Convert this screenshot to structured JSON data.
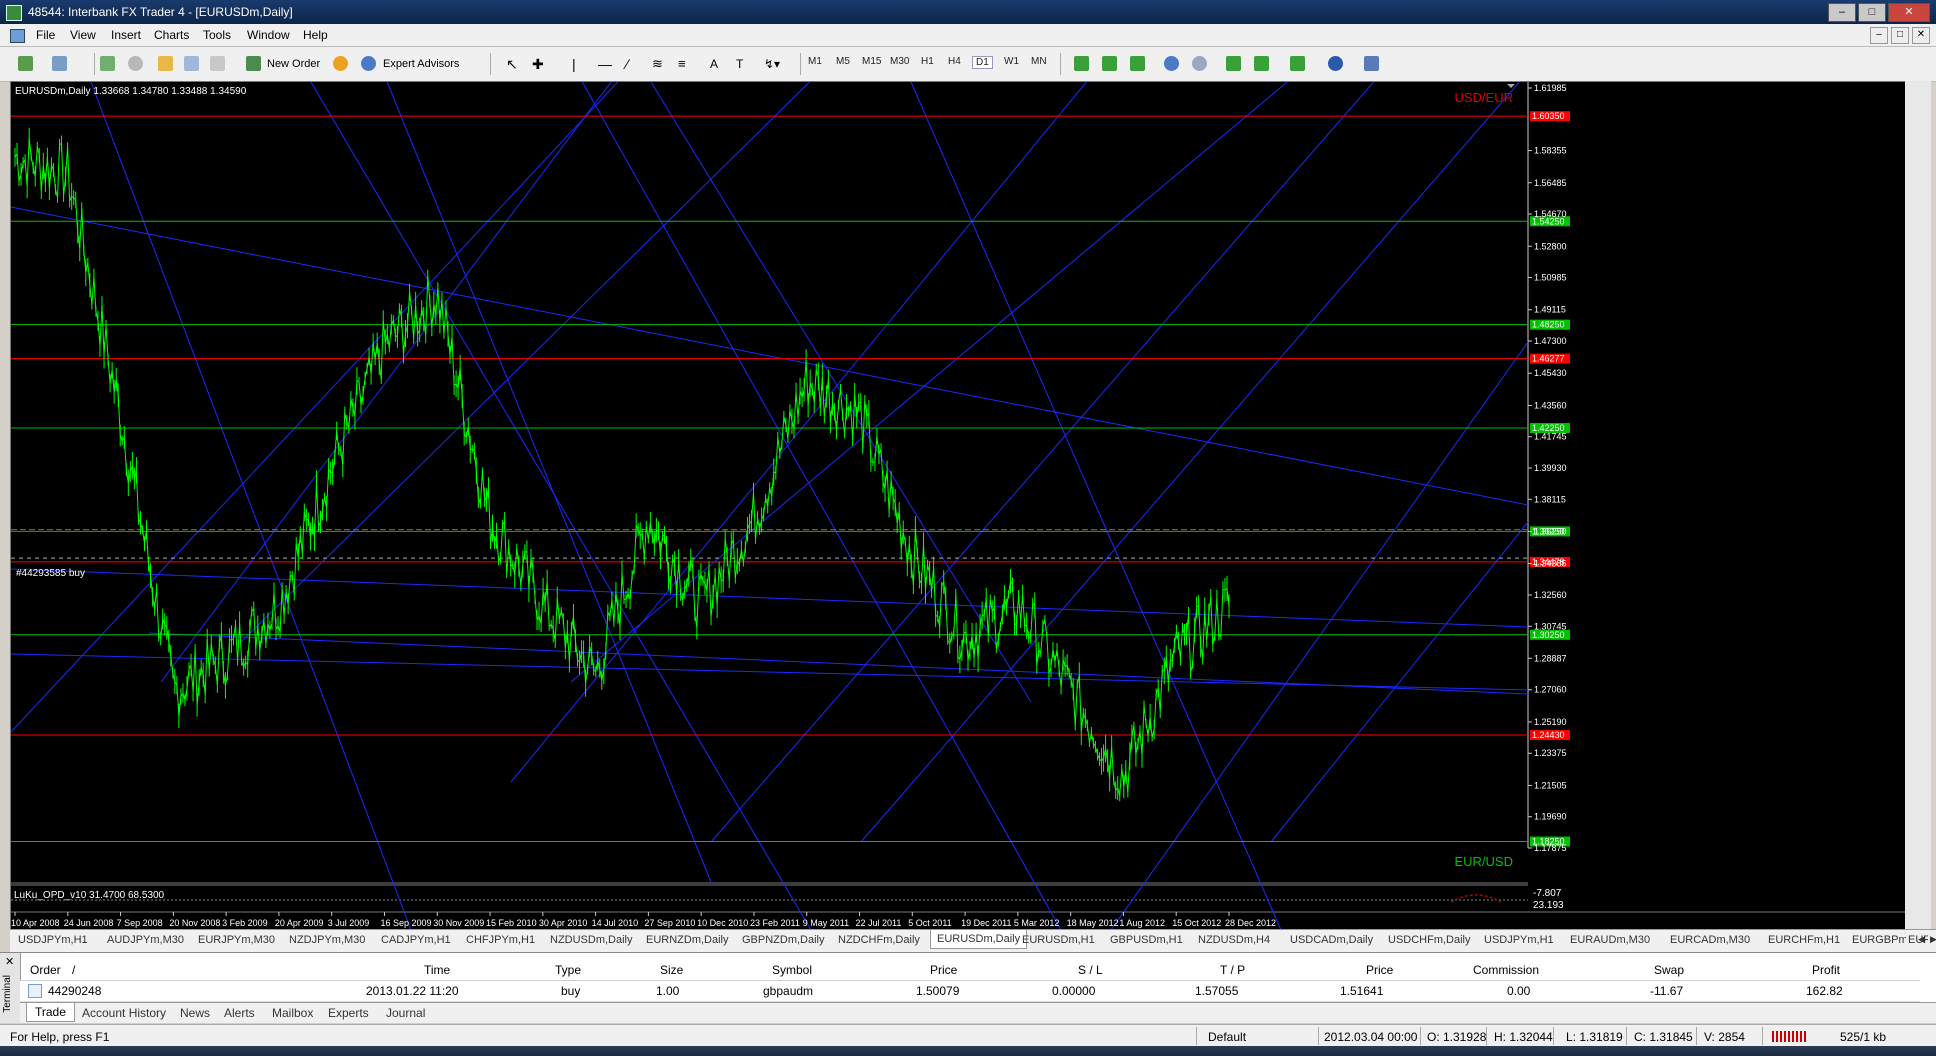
{
  "window": {
    "title": "48544: Interbank FX Trader 4 - [EURUSDm,Daily]"
  },
  "menu": [
    "File",
    "View",
    "Insert",
    "Charts",
    "Tools",
    "Window",
    "Help"
  ],
  "toolbar": {
    "new_order": "New Order",
    "expert_advisors": "Expert Advisors",
    "timeframes": [
      "M1",
      "M5",
      "M15",
      "M30",
      "H1",
      "H4",
      "D1",
      "W1",
      "MN"
    ],
    "active_timeframe": "D1"
  },
  "chart": {
    "header": "EURUSDm,Daily  1.33668 1.34780 1.33488 1.34590",
    "label_top_right": "USD/EUR",
    "label_bottom_right": "EUR/USD",
    "order_label": "#44293585 buy",
    "indicator_label": "LuKu_OPD_v10 31.4700 68.5300",
    "indicator_scale": [
      "-7.807",
      "23.193"
    ],
    "price_scale": [
      "1.61985",
      "1.58355",
      "1.56485",
      "1.54670",
      "1.52800",
      "1.50985",
      "1.49115",
      "1.47300",
      "1.45430",
      "1.43560",
      "1.41745",
      "1.39930",
      "1.38115",
      "1.36250",
      "1.34385",
      "1.32560",
      "1.30745",
      "1.28887",
      "1.27060",
      "1.25190",
      "1.23375",
      "1.21505",
      "1.19690",
      "1.17875"
    ],
    "marked_levels": [
      {
        "label": "1.60350",
        "color": "#ff0000"
      },
      {
        "label": "1.54250",
        "color": "#00c000"
      },
      {
        "label": "1.48250",
        "color": "#00c000"
      },
      {
        "label": "1.46277",
        "color": "#ff0000"
      },
      {
        "label": "1.42250",
        "color": "#00c000"
      },
      {
        "label": "1.36250",
        "color": "#00c000"
      },
      {
        "label": "1.34478",
        "color": "#ff0000"
      },
      {
        "label": "1.30250",
        "color": "#00c000"
      },
      {
        "label": "1.24430",
        "color": "#ff0000"
      },
      {
        "label": "1.18250",
        "color": "#00c000"
      }
    ],
    "date_labels": [
      "10 Apr 2008",
      "24 Jun 2008",
      "7 Sep 2008",
      "20 Nov 2008",
      "3 Feb 2009",
      "20 Apr 2009",
      "3 Jul 2009",
      "16 Sep 2009",
      "30 Nov 2009",
      "15 Feb 2010",
      "30 Apr 2010",
      "14 Jul 2010",
      "27 Sep 2010",
      "10 Dec 2010",
      "23 Feb 2011",
      "9 May 2011",
      "22 Jul 2011",
      "5 Oct 2011",
      "19 Dec 2011",
      "5 Mar 2012",
      "18 May 2012",
      "1 Aug 2012",
      "15 Oct 2012",
      "28 Dec 2012"
    ],
    "colors": {
      "candles": "#00ff00",
      "trendlines": "#1a2aff",
      "support": "#00c000",
      "resistance": "#ff0000"
    }
  },
  "chart_data": {
    "type": "line",
    "title": "EURUSDm,Daily",
    "x": [
      "10 Apr 2008",
      "24 Jun 2008",
      "7 Sep 2008",
      "20 Nov 2008",
      "3 Feb 2009",
      "20 Apr 2009",
      "3 Jul 2009",
      "16 Sep 2009",
      "30 Nov 2009",
      "15 Feb 2010",
      "30 Apr 2010",
      "14 Jul 2010",
      "27 Sep 2010",
      "10 Dec 2010",
      "23 Feb 2011",
      "9 May 2011",
      "22 Jul 2011",
      "5 Oct 2011",
      "19 Dec 2011",
      "5 Mar 2012",
      "18 May 2012",
      "1 Aug 2012",
      "15 Oct 2012",
      "28 Dec 2012"
    ],
    "series": [
      {
        "values": [
          1.58,
          1.57,
          1.43,
          1.27,
          1.29,
          1.32,
          1.4,
          1.47,
          1.5,
          1.37,
          1.32,
          1.28,
          1.37,
          1.32,
          1.37,
          1.45,
          1.43,
          1.35,
          1.3,
          1.32,
          1.27,
          1.22,
          1.29,
          1.32
        ]
      }
    ],
    "ylim": [
      1.17875,
      1.61985
    ]
  },
  "symbol_tabs": [
    "USDJPYm,H1",
    "AUDJPYm,M30",
    "EURJPYm,M30",
    "NZDJPYm,M30",
    "CADJPYm,H1",
    "CHFJPYm,H1",
    "NZDUSDm,Daily",
    "EURNZDm,Daily",
    "GBPNZDm,Daily",
    "NZDCHFm,Daily",
    "EURUSDm,H1",
    "GBPUSDm,H1",
    "NZDUSDm,H4",
    "USDCADm,Daily",
    "USDCHFm,Daily",
    "USDJPYm,H1",
    "EURAUDm,M30",
    "EURCADm,M30",
    "EURCHFm,H1",
    "EURGBPm,Daily",
    "EURNZD"
  ],
  "active_symbol_tab": "EURUSDm,Daily",
  "terminal": {
    "side_label": "Terminal",
    "columns": [
      "Order",
      "/",
      "Time",
      "Type",
      "Size",
      "Symbol",
      "Price",
      "S / L",
      "T / P",
      "Price",
      "Commission",
      "Swap",
      "Profit"
    ],
    "row": [
      "44290248",
      "2013.01.22 11:20",
      "buy",
      "1.00",
      "gbpaudm",
      "1.50079",
      "0.00000",
      "1.57055",
      "1.51641",
      "0.00",
      "-11.67",
      "162.82"
    ],
    "tabs": [
      "Trade",
      "Account History",
      "News",
      "Alerts",
      "Mailbox",
      "Experts",
      "Journal"
    ]
  },
  "status": {
    "help": "For Help, press F1",
    "profile": "Default",
    "datetime": "2012.03.04 00:00",
    "open": "O: 1.31928",
    "high": "H: 1.32044",
    "low": "L: 1.31819",
    "close": "C: 1.31845",
    "volume": "V: 2854",
    "traffic": "525/1 kb"
  }
}
